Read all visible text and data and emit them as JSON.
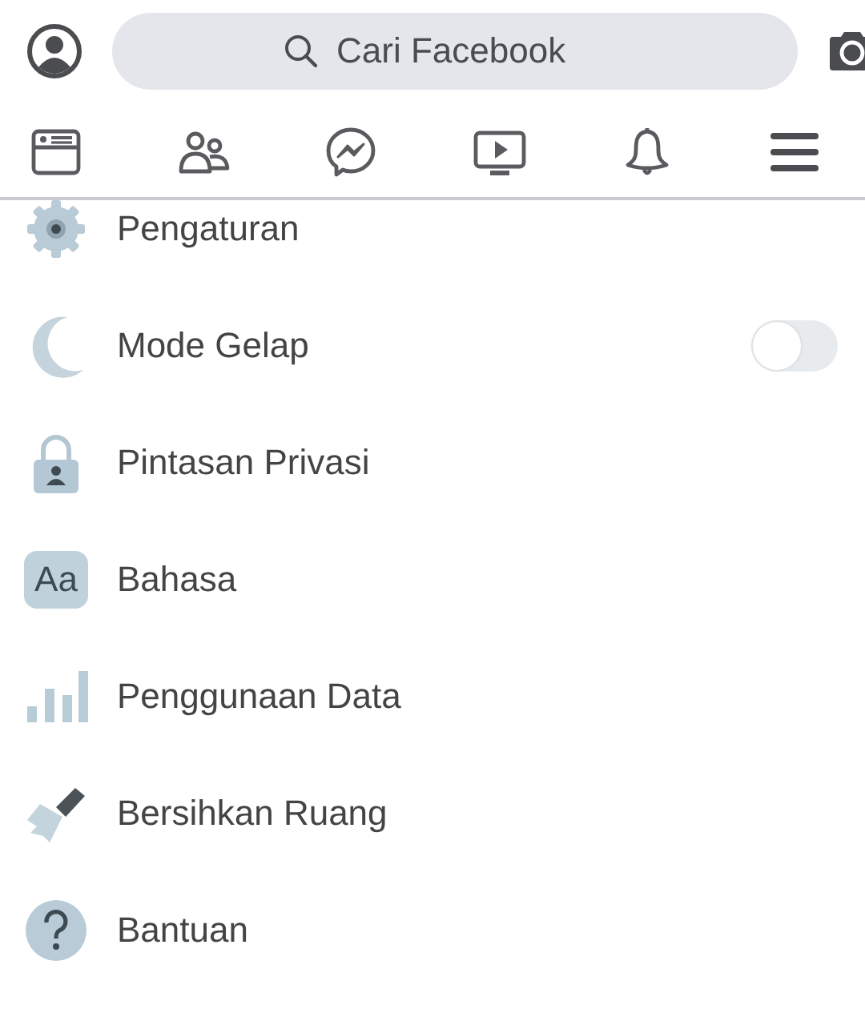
{
  "search": {
    "placeholder": "Cari Facebook"
  },
  "nav": [
    {
      "kind": "feed"
    },
    {
      "kind": "friends"
    },
    {
      "kind": "messenger"
    },
    {
      "kind": "video"
    },
    {
      "kind": "bell"
    },
    {
      "kind": "menu"
    }
  ],
  "menu_items": [
    {
      "label": "Pengaturan",
      "kind": "gear"
    },
    {
      "label": "Mode Gelap",
      "kind": "moon",
      "toggle": {
        "on": false
      }
    },
    {
      "label": "Pintasan Privasi",
      "kind": "lock"
    },
    {
      "label": "Bahasa",
      "kind": "language",
      "icon_text": "Aa"
    },
    {
      "label": "Penggunaan Data",
      "kind": "bars"
    },
    {
      "label": "Bersihkan Ruang",
      "kind": "broom"
    },
    {
      "label": "Bantuan",
      "kind": "help"
    }
  ]
}
